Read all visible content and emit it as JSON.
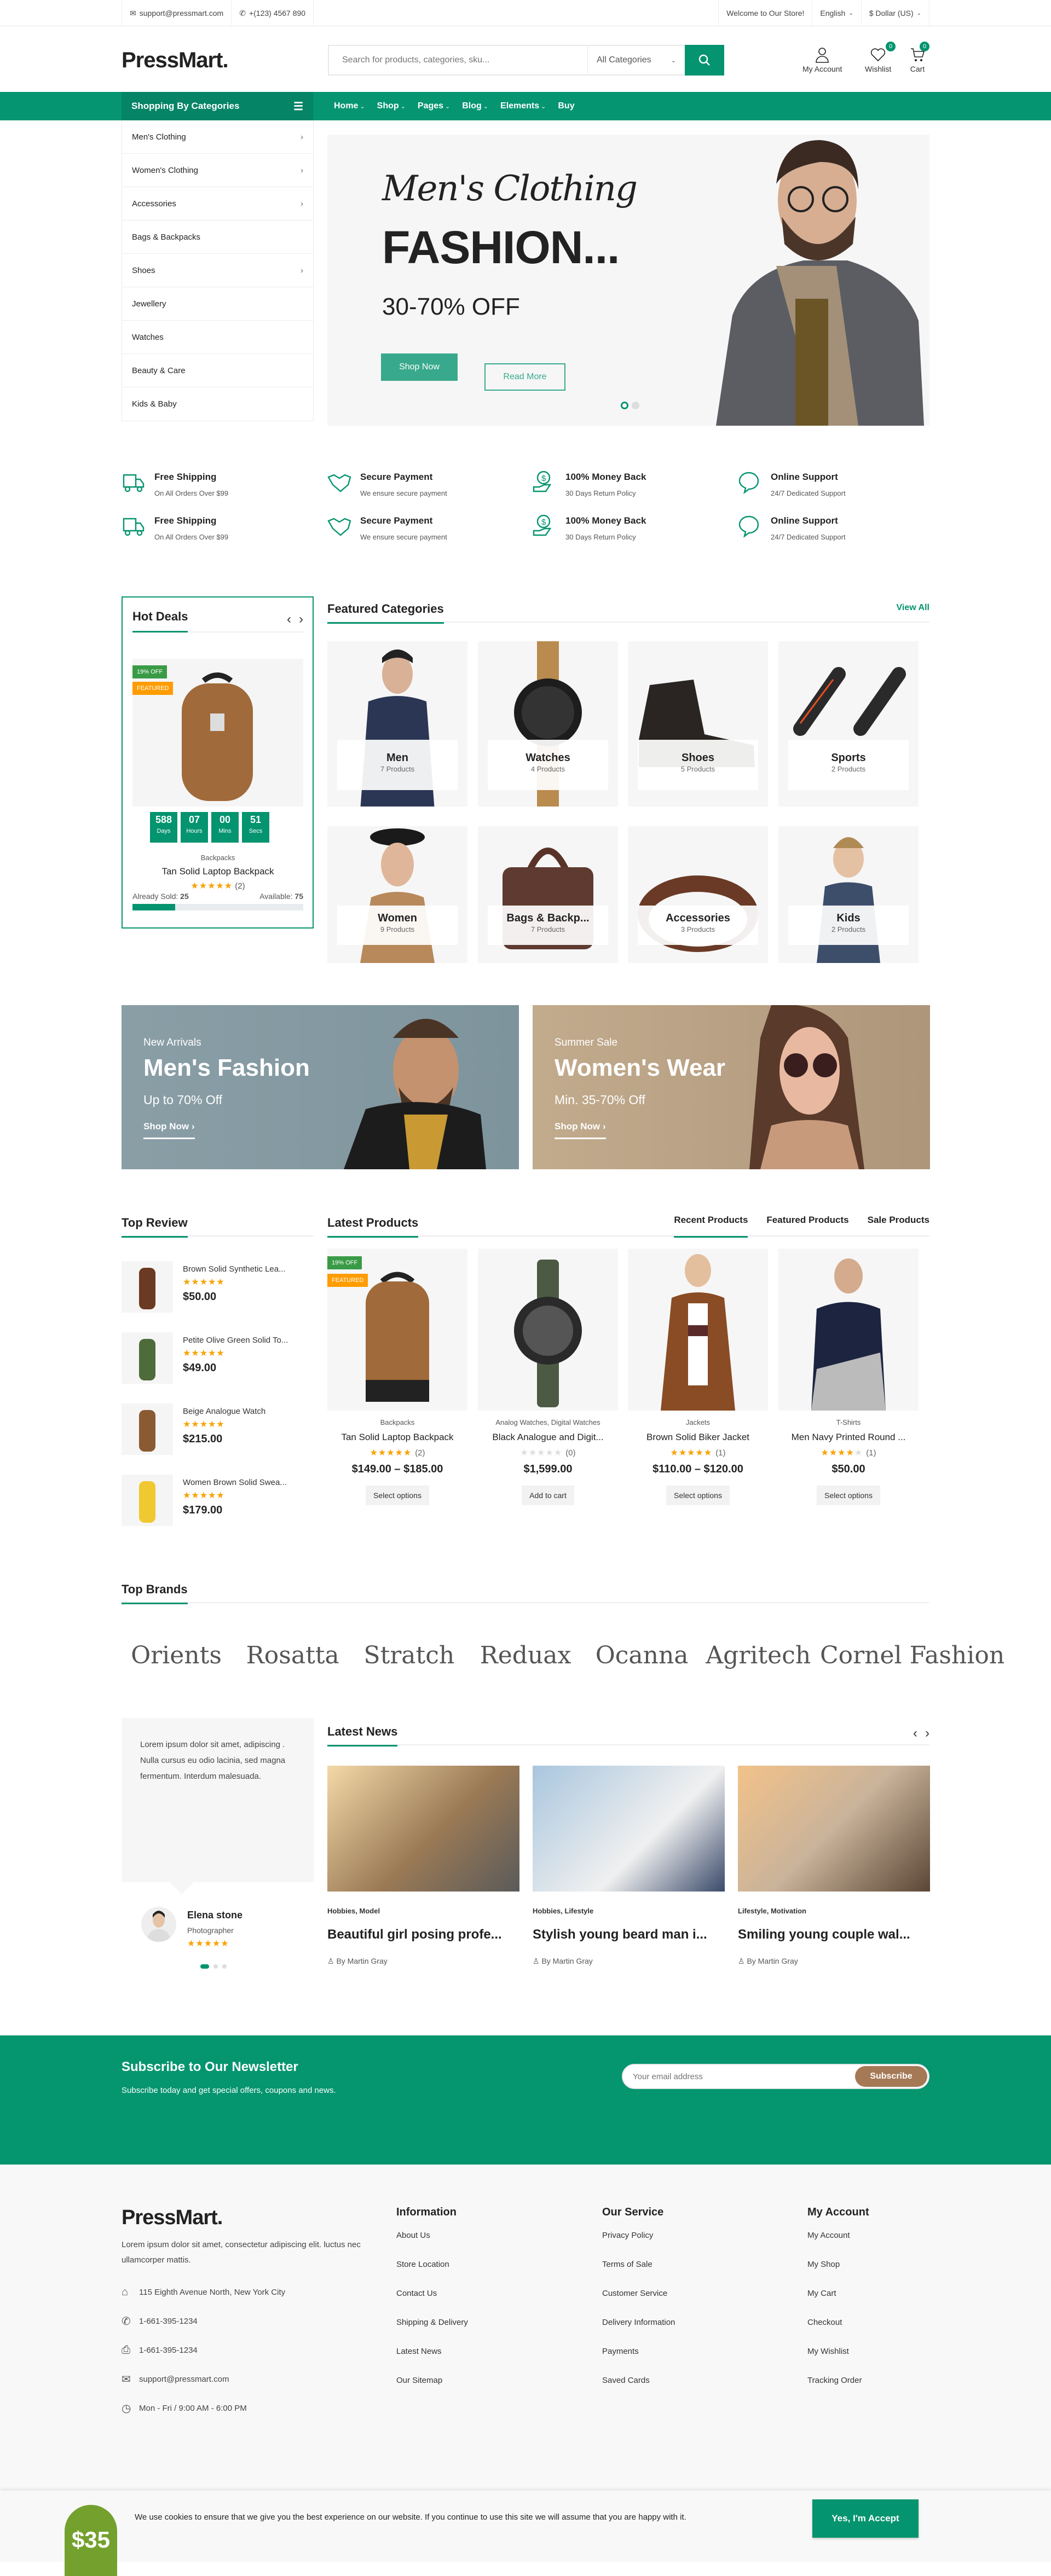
{
  "colors": {
    "accent": "#04946f",
    "subscribe": "#a57956",
    "featured_badge": "#ff9c00",
    "discount_badge": "#3a9b46",
    "star": "#f8a300"
  },
  "topbar": {
    "email": "support@pressmart.com",
    "phone": "+(123) 4567 890",
    "welcome": "Welcome to Our Store!",
    "language": "English",
    "currency": "$ Dollar (US)"
  },
  "header": {
    "logo": "PressMart.",
    "search_placeholder": "Search for products, categories, sku...",
    "search_category": "All Categories",
    "account_label": "My Account",
    "wishlist_label": "Wishlist",
    "wishlist_count": "0",
    "cart_label": "Cart",
    "cart_count": "0"
  },
  "nav": {
    "categories_title": "Shopping By Categories",
    "menu": [
      {
        "label": "Home",
        "dropdown": true
      },
      {
        "label": "Shop",
        "dropdown": true
      },
      {
        "label": "Pages",
        "dropdown": true
      },
      {
        "label": "Blog",
        "dropdown": true
      },
      {
        "label": "Elements",
        "dropdown": true
      },
      {
        "label": "Buy",
        "dropdown": false
      }
    ]
  },
  "sidebar": {
    "categories": [
      {
        "label": "Men's Clothing",
        "arrow": true
      },
      {
        "label": "Women's Clothing",
        "arrow": true
      },
      {
        "label": "Accessories",
        "arrow": true
      },
      {
        "label": "Bags & Backpacks",
        "arrow": false
      },
      {
        "label": "Shoes",
        "arrow": true
      },
      {
        "label": "Jewellery",
        "arrow": false
      },
      {
        "label": "Watches",
        "arrow": false
      },
      {
        "label": "Beauty & Care",
        "arrow": false
      },
      {
        "label": "Kids & Baby",
        "arrow": false
      }
    ]
  },
  "hero": {
    "script_title": "Men's Clothing",
    "title": "FASHION...",
    "subtitle": "30-70% OFF",
    "shop_now": "Shop Now",
    "read_more": "Read More",
    "slides": 2,
    "active_slide": 1
  },
  "features": [
    {
      "icon": "truck-icon",
      "title": "Free Shipping",
      "text": "On All Orders Over $99"
    },
    {
      "icon": "handshake-icon",
      "title": "Secure Payment",
      "text": "We ensure secure payment"
    },
    {
      "icon": "money-back-icon",
      "title": "100% Money Back",
      "text": "30 Days Return Policy"
    },
    {
      "icon": "chat-icon",
      "title": "Online Support",
      "text": "24/7 Dedicated Support"
    },
    {
      "icon": "truck-icon",
      "title": "Free Shipping",
      "text": "On All Orders Over $99"
    },
    {
      "icon": "handshake-icon",
      "title": "Secure Payment",
      "text": "We ensure secure payment"
    },
    {
      "icon": "money-back-icon",
      "title": "100% Money Back",
      "text": "30 Days Return Policy"
    },
    {
      "icon": "chat-icon",
      "title": "Online Support",
      "text": "24/7 Dedicated Support"
    }
  ],
  "hot_deals": {
    "title": "Hot Deals",
    "discount": "19% OFF",
    "featured": "FEATURED",
    "countdown": [
      {
        "value": "588",
        "unit": "Days"
      },
      {
        "value": "07",
        "unit": "Hours"
      },
      {
        "value": "00",
        "unit": "Mins"
      },
      {
        "value": "51",
        "unit": "Secs"
      }
    ],
    "category": "Backpacks",
    "name": "Tan Solid Laptop Backpack",
    "rating": 5,
    "reviews": "(2)",
    "sold_label": "Already Sold:",
    "sold": "25",
    "available_label": "Available:",
    "available": "75",
    "progress_percent": 25
  },
  "featured_categories": {
    "title": "Featured Categories",
    "view_all": "View All",
    "items": [
      {
        "name": "Men",
        "count": "7 Products"
      },
      {
        "name": "Watches",
        "count": "4 Products"
      },
      {
        "name": "Shoes",
        "count": "5 Products"
      },
      {
        "name": "Sports",
        "count": "2 Products"
      },
      {
        "name": "Women",
        "count": "9 Products"
      },
      {
        "name": "Bags & Backp...",
        "count": "7 Products"
      },
      {
        "name": "Accessories",
        "count": "3 Products"
      },
      {
        "name": "Kids",
        "count": "2 Products"
      }
    ]
  },
  "banners": [
    {
      "kicker": "New Arrivals",
      "title": "Men's Fashion",
      "subtitle": "Up to 70% Off",
      "link": "Shop Now"
    },
    {
      "kicker": "Summer Sale",
      "title": "Women's Wear",
      "subtitle": "Min. 35-70% Off",
      "link": "Shop Now"
    }
  ],
  "top_review": {
    "title": "Top Review",
    "items": [
      {
        "name": "Brown Solid Synthetic Lea...",
        "rating": 5,
        "price": "$50.00"
      },
      {
        "name": "Petite Olive Green Solid To...",
        "rating": 5,
        "price": "$49.00"
      },
      {
        "name": "Beige Analogue Watch",
        "rating": 5,
        "price": "$215.00"
      },
      {
        "name": "Women Brown Solid Swea...",
        "rating": 5,
        "price": "$179.00"
      }
    ]
  },
  "latest_products": {
    "title": "Latest Products",
    "tabs": [
      {
        "label": "Recent Products",
        "active": true
      },
      {
        "label": "Featured Products",
        "active": false
      },
      {
        "label": "Sale Products",
        "active": false
      }
    ],
    "items": [
      {
        "category": "Backpacks",
        "name": "Tan Solid Laptop Backpack",
        "rating": 5,
        "reviews": "(2)",
        "price": "$149.00 – $185.00",
        "button": "Select options",
        "discount": "19% OFF",
        "featured": "FEATURED"
      },
      {
        "category": "Analog Watches, Digital Watches",
        "name": "Black Analogue and Digit...",
        "rating": 0,
        "reviews": "(0)",
        "price": "$1,599.00",
        "button": "Add to cart"
      },
      {
        "category": "Jackets",
        "name": "Brown Solid Biker Jacket",
        "rating": 5,
        "reviews": "(1)",
        "price": "$110.00 – $120.00",
        "button": "Select options"
      },
      {
        "category": "T-Shirts",
        "name": "Men Navy Printed Round ...",
        "rating": 4,
        "reviews": "(1)",
        "price": "$50.00",
        "button": "Select options"
      }
    ]
  },
  "top_brands": {
    "title": "Top Brands",
    "items": [
      "Orients",
      "Rosatta",
      "Stratch",
      "Reduax",
      "Ocanna",
      "Agritech",
      "Cornel Fashion"
    ]
  },
  "testimonial": {
    "text": "Lorem ipsum dolor sit amet, adipiscing . Nulla cursus eu odio lacinia, sed magna fermentum. Interdum malesuada.",
    "name": "Elena stone",
    "role": "Photographer",
    "rating": 5,
    "dots": 3,
    "active_dot": 1
  },
  "latest_news": {
    "title": "Latest News",
    "items": [
      {
        "category": "Hobbies, Model",
        "title": "Beautiful girl posing profe...",
        "author": "By Martin Gray"
      },
      {
        "category": "Hobbies, Lifestyle",
        "title": "Stylish young beard man i...",
        "author": "By Martin Gray"
      },
      {
        "category": "Lifestyle, Motivation",
        "title": "Smiling young couple wal...",
        "author": "By Martin Gray"
      }
    ]
  },
  "newsletter": {
    "title": "Subscribe to Our Newsletter",
    "text": "Subscribe today and get special offers, coupons and news.",
    "placeholder": "Your email address",
    "button": "Subscribe"
  },
  "footer": {
    "logo": "PressMart.",
    "about": "Lorem ipsum dolor sit amet, consectetur adipiscing elit. luctus nec ullamcorper mattis.",
    "contact": [
      {
        "icon": "home-icon",
        "text": "115 Eighth Avenue North, New York City"
      },
      {
        "icon": "phone-icon",
        "text": "1-661-395-1234"
      },
      {
        "icon": "fax-icon",
        "text": "1-661-395-1234"
      },
      {
        "icon": "mail-icon",
        "text": "support@pressmart.com"
      },
      {
        "icon": "clock-icon",
        "text": "Mon - Fri / 9:00 AM - 6:00 PM"
      }
    ],
    "columns": [
      {
        "title": "Information",
        "links": [
          "About Us",
          "Store Location",
          "Contact Us",
          "Shipping & Delivery",
          "Latest News",
          "Our Sitemap"
        ]
      },
      {
        "title": "Our Service",
        "links": [
          "Privacy Policy",
          "Terms of Sale",
          "Customer Service",
          "Delivery Information",
          "Payments",
          "Saved Cards"
        ]
      },
      {
        "title": "My Account",
        "links": [
          "My Account",
          "My Shop",
          "My Cart",
          "Checkout",
          "My Wishlist",
          "Tracking Order"
        ]
      }
    ]
  },
  "cookie": {
    "message": "We use cookies to ensure that we give you the best experience on our website. If you continue to use this site we will assume that you are happy with it.",
    "button": "Yes, I'm Accept",
    "promo_price": "$35"
  }
}
